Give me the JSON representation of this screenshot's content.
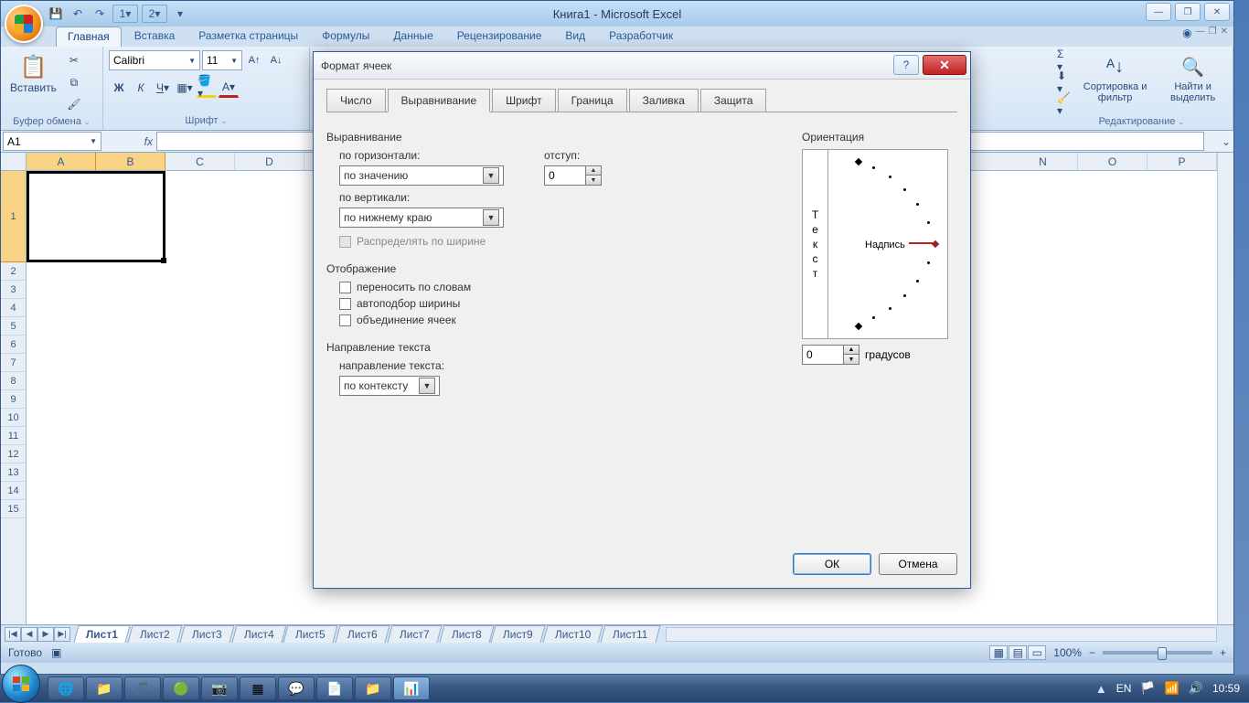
{
  "window": {
    "title": "Книга1 - Microsoft Excel"
  },
  "ribbon": {
    "tabs": [
      "Главная",
      "Вставка",
      "Разметка страницы",
      "Формулы",
      "Данные",
      "Рецензирование",
      "Вид",
      "Разработчик"
    ],
    "active_tab": "Главная",
    "groups": {
      "clipboard": {
        "label": "Буфер обмена",
        "paste": "Вставить"
      },
      "font": {
        "label": "Шрифт",
        "name": "Calibri",
        "size": "11"
      },
      "editing": {
        "label": "Редактирование",
        "sort": "Сортировка и фильтр",
        "find": "Найти и выделить"
      }
    }
  },
  "namebox": "A1",
  "grid": {
    "columns": [
      "A",
      "B",
      "C",
      "D",
      "N",
      "O",
      "P"
    ],
    "rows": [
      "1",
      "2",
      "3",
      "4",
      "5",
      "6",
      "7",
      "8",
      "9",
      "10",
      "11",
      "12",
      "13",
      "14",
      "15"
    ]
  },
  "sheets": [
    "Лист1",
    "Лист2",
    "Лист3",
    "Лист4",
    "Лист5",
    "Лист6",
    "Лист7",
    "Лист8",
    "Лист9",
    "Лист10",
    "Лист11"
  ],
  "status": {
    "ready": "Готово"
  },
  "zoom": {
    "pct": "100%"
  },
  "dialog": {
    "title": "Формат ячеек",
    "tabs": [
      "Число",
      "Выравнивание",
      "Шрифт",
      "Граница",
      "Заливка",
      "Защита"
    ],
    "active_tab": "Выравнивание",
    "align": {
      "section": "Выравнивание",
      "horiz_label": "по горизонтали:",
      "horiz_value": "по значению",
      "vert_label": "по вертикали:",
      "vert_value": "по нижнему краю",
      "indent_label": "отступ:",
      "indent_value": "0",
      "distribute": "Распределять по ширине"
    },
    "display": {
      "section": "Отображение",
      "wrap": "переносить по словам",
      "shrink": "автоподбор ширины",
      "merge": "объединение ячеек"
    },
    "textdir": {
      "section": "Направление текста",
      "label": "направление текста:",
      "value": "по контексту"
    },
    "orient": {
      "section": "Ориентация",
      "vtext": "Текст",
      "htext": "Надпись",
      "deg_value": "0",
      "deg_label": "градусов"
    },
    "ok": "ОК",
    "cancel": "Отмена"
  },
  "taskbar": {
    "lang": "EN",
    "clock": "10:59"
  }
}
